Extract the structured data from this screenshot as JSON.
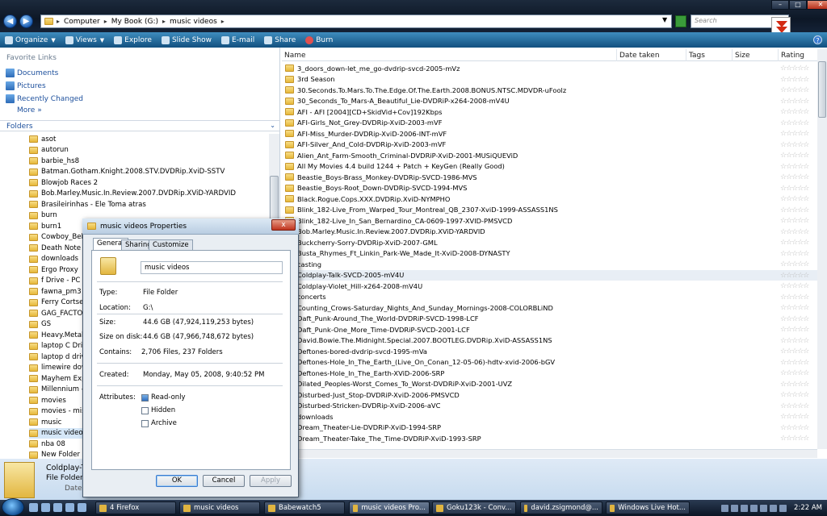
{
  "address": {
    "crumbs": [
      "Computer",
      "My Book (G:)",
      "music videos"
    ],
    "search_placeholder": "Search"
  },
  "toolbar": {
    "organize": "Organize",
    "views": "Views",
    "explore": "Explore",
    "slideshow": "Slide Show",
    "email": "E-mail",
    "share": "Share",
    "burn": "Burn",
    "help": "?"
  },
  "nav": {
    "favorites_header": "Favorite Links",
    "favorites": [
      "Documents",
      "Pictures",
      "Recently Changed"
    ],
    "more": "More",
    "folders_header": "Folders",
    "folders": [
      "asot",
      "autorun",
      "barbie_hs8",
      "Batman.Gotham.Knight.2008.STV.DVDRip.XviD-SSTV",
      "Blowjob Races 2",
      "Bob.Marley.Music.In.Review.2007.DVDRip.XViD-YARDVID",
      "Brasileirinhas - Ele Toma atras",
      "burn",
      "burn1",
      "Cowboy_Bebo",
      "Death Note",
      "downloads",
      "Ergo Proxy",
      "f Drive - PC",
      "fawna_pm3",
      "Ferry Cortsen",
      "GAG_FACTOR",
      "GS",
      "Heavy.Metal.m",
      "laptop C Drive",
      "laptop d drive",
      "limewire down",
      "Mayhem Exple",
      "Millennium - S",
      "movies",
      "movies - misc",
      "music",
      "music videos",
      "nba 08",
      "New Folder"
    ],
    "selected_folder": "music videos"
  },
  "list": {
    "columns": [
      "Name",
      "Date taken",
      "Tags",
      "Size",
      "Rating"
    ],
    "rating_stars": "☆☆☆☆☆",
    "files": [
      "3_doors_down-let_me_go-dvdrip-svcd-2005-mVz",
      "3rd Season",
      "30.Seconds.To.Mars.To.The.Edge.Of.The.Earth.2008.BONUS.NTSC.MDVDR-uFoolz",
      "30_Seconds_To_Mars-A_Beautiful_Lie-DVDRiP-x264-2008-mV4U",
      "AFI - AFI [2004][CD+SkidVid+Cov]192Kbps",
      "AFI-Girls_Not_Grey-DVDRip-XviD-2003-mVF",
      "AFI-Miss_Murder-DVDRip-XviD-2006-INT-mVF",
      "AFI-Silver_And_Cold-DVDRip-XviD-2003-mVF",
      "Alien_Ant_Farm-Smooth_Criminal-DVDRiP-XviD-2001-MUSiQUEViD",
      "All My Movies 4.4 build 1244 + Patch + KeyGen (Really Good)",
      "Beastie_Boys-Brass_Monkey-DVDRip-SVCD-1986-MVS",
      "Beastie_Boys-Root_Down-DVDRip-SVCD-1994-MVS",
      "Black.Rogue.Cops.XXX.DVDRip.XviD-NYMPHO",
      "Blink_182-Live_From_Warped_Tour_Montreal_QB_2307-XviD-1999-ASSASS1NS",
      "Blink_182-Live_In_San_Bernardino_CA-0609-1997-XVID-PMSVCD",
      "Bob.Marley.Music.In.Review.2007.DVDRip.XViD-YARDVID",
      "Buckcherry-Sorry-DVDRip-XviD-2007-GML",
      "Busta_Rhymes_Ft_Linkin_Park-We_Made_It-XviD-2008-DYNASTY",
      "casting",
      "Coldplay-Talk-SVCD-2005-mV4U",
      "Coldplay-Violet_Hill-x264-2008-mV4U",
      "concerts",
      "Counting_Crows-Saturday_Nights_And_Sunday_Mornings-2008-COLORBLiND",
      "Daft_Punk-Around_The_World-DVDRiP-SVCD-1998-LCF",
      "Daft_Punk-One_More_Time-DVDRiP-SVCD-2001-LCF",
      "David.Bowie.The.Midnight.Special.2007.BOOTLEG.DVDRip.XviD-ASSASS1NS",
      "Deftones-bored-dvdrip-svcd-1995-mVa",
      "Deftones-Hole_In_The_Earth_(Live_On_Conan_12-05-06)-hdtv-xvid-2006-bGV",
      "Deftones-Hole_In_The_Earth-XViD-2006-SRP",
      "Dilated_Peoples-Worst_Comes_To_Worst-DVDRiP-XviD-2001-UVZ",
      "Disturbed-Just_Stop-DVDRiP-XviD-2006-PMSVCD",
      "Disturbed-Stricken-DVDRip-XviD-2006-aVC",
      "downloads",
      "Dream_Theater-Lie-DVDRiP-XviD-1994-SRP",
      "Dream_Theater-Take_The_Time-DVDRiP-XviD-1993-SRP"
    ],
    "highlighted_file": "Coldplay-Talk-SVCD-2005-mV4U"
  },
  "details": {
    "name": "Coldplay-Ti",
    "type": "File Folder",
    "date_label": "Date m"
  },
  "dialog": {
    "title": "music videos Properties",
    "close": "x",
    "tabs": [
      "General",
      "Sharing",
      "Customize"
    ],
    "folder_name": "music videos",
    "props": [
      {
        "label": "Type:",
        "value": "File Folder"
      },
      {
        "label": "Location:",
        "value": "G:\\"
      },
      {
        "label": "Size:",
        "value": "44.6 GB (47,924,119,253 bytes)"
      },
      {
        "label": "Size on disk:",
        "value": "44.6 GB (47,966,748,672 bytes)"
      },
      {
        "label": "Contains:",
        "value": "2,706 Files, 237 Folders"
      },
      {
        "label": "Created:",
        "value": "Monday, May 05, 2008, 9:40:52 PM"
      },
      {
        "label": "Attributes:",
        "value": ""
      }
    ],
    "attributes": [
      {
        "label": "Read-only",
        "checked": true
      },
      {
        "label": "Hidden",
        "checked": false
      },
      {
        "label": "Archive",
        "checked": false
      }
    ],
    "ok": "OK",
    "cancel": "Cancel",
    "apply": "Apply"
  },
  "taskbar": {
    "tasks": [
      "4 Firefox",
      "music videos",
      "Babewatch5",
      "music videos Pro...",
      "Goku123k - Conv...",
      "david.zsigmond@...",
      "Windows Live Hot..."
    ],
    "active_task": "music videos Pro...",
    "clock": "2:22 AM"
  }
}
